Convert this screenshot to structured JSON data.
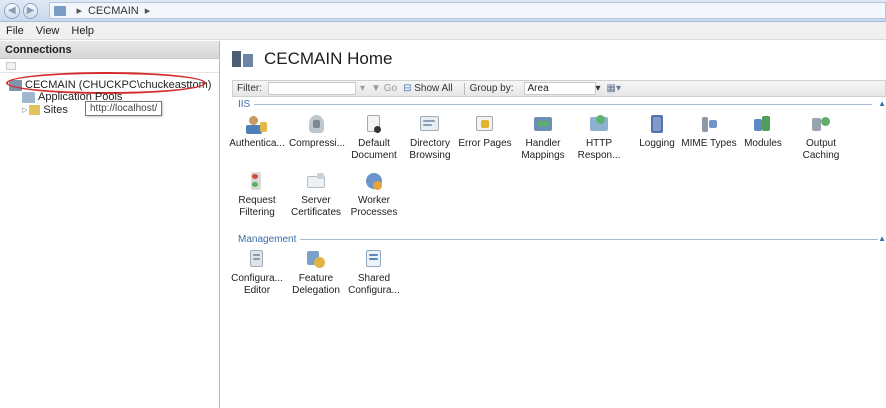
{
  "address_bar": {
    "crumbs": [
      "CECMAIN"
    ]
  },
  "menu": [
    "File",
    "View",
    "Help"
  ],
  "connections": {
    "title": "Connections",
    "tree": {
      "root": "CECMAIN (CHUCKPC\\chuckeasttom)",
      "application_pools": "Application Pools",
      "sites": "Sites"
    },
    "tooltip": "http://localhost/"
  },
  "main": {
    "title": "CECMAIN Home",
    "filter": {
      "label": "Filter:",
      "go": "Go",
      "show_all": "Show All",
      "group_by_label": "Group by:",
      "group_by_value": "Area"
    },
    "groups": [
      {
        "name": "IIS",
        "features": [
          {
            "label": [
              "Authentica..."
            ],
            "icon": "authentication-icon"
          },
          {
            "label": [
              "Compressi..."
            ],
            "icon": "compression-icon"
          },
          {
            "label": [
              "Default",
              "Document"
            ],
            "icon": "default-document-icon"
          },
          {
            "label": [
              "Directory",
              "Browsing"
            ],
            "icon": "directory-browsing-icon"
          },
          {
            "label": [
              "Error Pages"
            ],
            "icon": "error-pages-icon"
          },
          {
            "label": [
              "Handler",
              "Mappings"
            ],
            "icon": "handler-mappings-icon"
          },
          {
            "label": [
              "HTTP",
              "Respon..."
            ],
            "icon": "http-response-icon"
          },
          {
            "label": [
              "Logging"
            ],
            "icon": "logging-icon"
          },
          {
            "label": [
              "MIME Types"
            ],
            "icon": "mime-types-icon"
          },
          {
            "label": [
              "Modules"
            ],
            "icon": "modules-icon"
          },
          {
            "label": [
              "Output",
              "Caching"
            ],
            "icon": "output-caching-icon"
          },
          {
            "label": [
              "Request",
              "Filtering"
            ],
            "icon": "request-filtering-icon"
          },
          {
            "label": [
              "Server",
              "Certificates"
            ],
            "icon": "server-certificates-icon"
          },
          {
            "label": [
              "Worker",
              "Processes"
            ],
            "icon": "worker-processes-icon"
          }
        ]
      },
      {
        "name": "Management",
        "features": [
          {
            "label": [
              "Configura...",
              "Editor"
            ],
            "icon": "configuration-editor-icon"
          },
          {
            "label": [
              "Feature",
              "Delegation"
            ],
            "icon": "feature-delegation-icon"
          },
          {
            "label": [
              "Shared",
              "Configura..."
            ],
            "icon": "shared-configuration-icon"
          }
        ]
      }
    ]
  },
  "colors": {
    "accent": "#3b6ea5",
    "highlight_ellipse": "#d42a2a"
  }
}
